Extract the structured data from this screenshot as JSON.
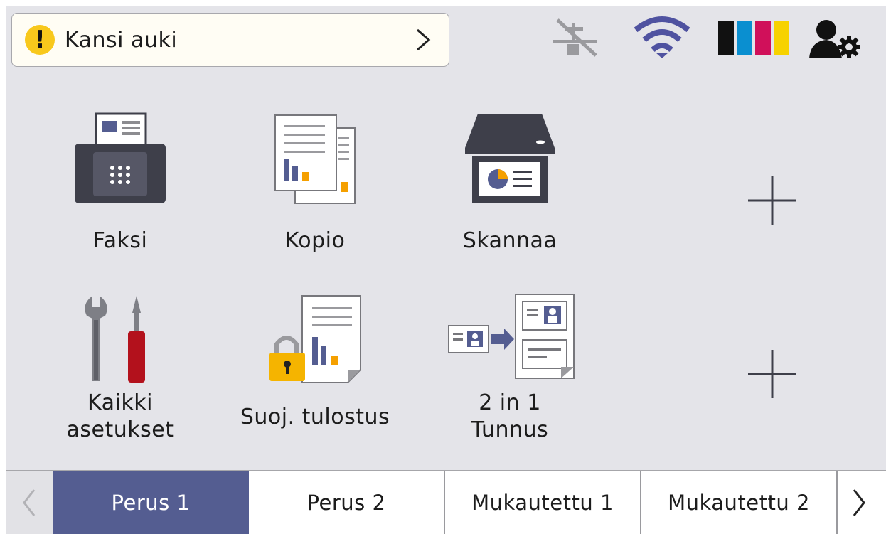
{
  "status": {
    "message": "Kansi auki",
    "icon": "warning-icon"
  },
  "status_icons": [
    "wired-lan-disabled-icon",
    "wifi-icon",
    "ink-level-icon",
    "user-settings-icon"
  ],
  "colors": {
    "accent": "#545d91",
    "warning": "#f8c81c",
    "ink_black": "#111111",
    "ink_cyan": "#0a8fd0",
    "ink_magenta": "#d0105a",
    "ink_yellow": "#f7d200",
    "wifi": "#4f52a0"
  },
  "tiles": [
    {
      "label": "Faksi",
      "icon": "fax-icon"
    },
    {
      "label": "Kopio",
      "icon": "copy-icon"
    },
    {
      "label": "Skannaa",
      "icon": "scan-icon"
    },
    {
      "label": "Kaikki\nasetukset",
      "icon": "tools-icon"
    },
    {
      "label": "Suoj. tulostus",
      "icon": "secure-print-icon"
    },
    {
      "label": "2 in 1\nTunnus",
      "icon": "id-copy-icon"
    }
  ],
  "tabs": [
    {
      "label": "Perus 1",
      "active": true
    },
    {
      "label": "Perus 2",
      "active": false
    },
    {
      "label": "Mukautettu 1",
      "active": false
    },
    {
      "label": "Mukautettu 2",
      "active": false
    }
  ]
}
